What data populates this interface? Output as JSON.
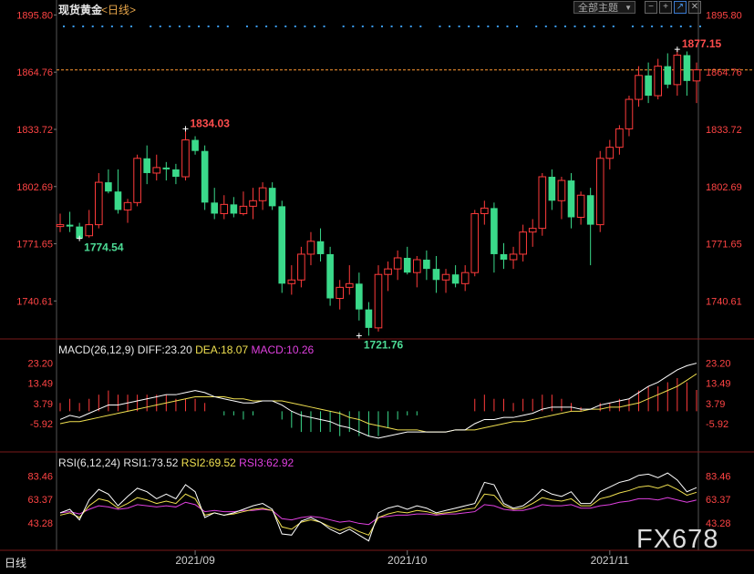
{
  "header": {
    "title": "现货黄金",
    "period": "<日线>",
    "theme_label": "全部主题",
    "theme_arrow": "▼"
  },
  "toolbar": [
    {
      "name": "minus-icon",
      "glyph": "−"
    },
    {
      "name": "plus-icon",
      "glyph": "+"
    },
    {
      "name": "line-chart-icon",
      "glyph": "↗"
    },
    {
      "name": "close-icon",
      "glyph": "✕"
    }
  ],
  "colors": {
    "up": "#ff3b3b",
    "down": "#3ad98a",
    "axis_up": "#ff4444",
    "diff": "#ffffff",
    "dea": "#f0e050",
    "macd": "#e040e0",
    "rsi1": "#ffffff",
    "rsi2": "#f0e050",
    "rsi3": "#e040e0",
    "ref": "#ff9933",
    "dots": "#3a9af0"
  },
  "bottom_tab": "日线",
  "watermark": "FX678",
  "chart_data": [
    {
      "type": "candlestick",
      "title": "现货黄金",
      "yticks": [
        "1895.80",
        "1864.76",
        "1833.72",
        "1802.69",
        "1771.65",
        "1740.61"
      ],
      "ylim": [
        1720,
        1897
      ],
      "xlabels": [
        {
          "i": 14,
          "label": "2021/09"
        },
        {
          "i": 36,
          "label": "2021/10"
        },
        {
          "i": 57,
          "label": "2021/11"
        }
      ],
      "current_price": 1866,
      "annotations": [
        {
          "label": "1834.03",
          "i": 13,
          "value": 1834.03,
          "kind": "high"
        },
        {
          "label": "1774.54",
          "i": 2,
          "value": 1774.54,
          "kind": "low"
        },
        {
          "label": "1721.76",
          "i": 31,
          "value": 1721.76,
          "kind": "low"
        },
        {
          "label": "1877.15",
          "i": 64,
          "value": 1877.15,
          "kind": "high"
        }
      ],
      "ohlc": [
        [
          1781,
          1788,
          1778,
          1782
        ],
        [
          1782,
          1789,
          1778,
          1781
        ],
        [
          1781,
          1783,
          1774.54,
          1774.5
        ],
        [
          1776,
          1790,
          1775,
          1782
        ],
        [
          1782,
          1810,
          1780,
          1805
        ],
        [
          1805,
          1812,
          1799,
          1800
        ],
        [
          1800,
          1812,
          1788,
          1790
        ],
        [
          1790,
          1796,
          1783,
          1794
        ],
        [
          1794,
          1820,
          1792,
          1818
        ],
        [
          1818,
          1825,
          1804,
          1810
        ],
        [
          1810,
          1820,
          1806,
          1813
        ],
        [
          1813,
          1816,
          1806,
          1812
        ],
        [
          1812,
          1815,
          1804,
          1808
        ],
        [
          1808,
          1834.03,
          1806,
          1828
        ],
        [
          1828,
          1830,
          1820,
          1822
        ],
        [
          1822,
          1825,
          1790,
          1794
        ],
        [
          1794,
          1802,
          1785,
          1788
        ],
        [
          1788,
          1798,
          1785,
          1793
        ],
        [
          1793,
          1797,
          1786,
          1788
        ],
        [
          1788,
          1800,
          1787,
          1792
        ],
        [
          1792,
          1802,
          1785,
          1795
        ],
        [
          1795,
          1805,
          1790,
          1802
        ],
        [
          1802,
          1805,
          1790,
          1792
        ],
        [
          1792,
          1795,
          1745,
          1750
        ],
        [
          1750,
          1760,
          1744,
          1752
        ],
        [
          1752,
          1770,
          1748,
          1766
        ],
        [
          1766,
          1778,
          1760,
          1773
        ],
        [
          1773,
          1780,
          1762,
          1766
        ],
        [
          1766,
          1770,
          1738,
          1742
        ],
        [
          1742,
          1752,
          1736,
          1748
        ],
        [
          1748,
          1760,
          1744,
          1750
        ],
        [
          1750,
          1756,
          1730,
          1736
        ],
        [
          1736,
          1740,
          1721.76,
          1726
        ],
        [
          1726,
          1760,
          1724,
          1755
        ],
        [
          1755,
          1762,
          1746,
          1758
        ],
        [
          1758,
          1768,
          1752,
          1764
        ],
        [
          1764,
          1770,
          1755,
          1756
        ],
        [
          1756,
          1765,
          1748,
          1763
        ],
        [
          1763,
          1768,
          1752,
          1758
        ],
        [
          1758,
          1765,
          1745,
          1752
        ],
        [
          1752,
          1758,
          1745,
          1755
        ],
        [
          1755,
          1760,
          1748,
          1750
        ],
        [
          1750,
          1760,
          1746,
          1756
        ],
        [
          1756,
          1790,
          1754,
          1788
        ],
        [
          1788,
          1795,
          1782,
          1791
        ],
        [
          1791,
          1794,
          1756,
          1766
        ],
        [
          1766,
          1772,
          1758,
          1763
        ],
        [
          1763,
          1770,
          1758,
          1766
        ],
        [
          1766,
          1782,
          1762,
          1778
        ],
        [
          1778,
          1785,
          1770,
          1780
        ],
        [
          1780,
          1810,
          1776,
          1808
        ],
        [
          1808,
          1812,
          1790,
          1795
        ],
        [
          1795,
          1808,
          1785,
          1806
        ],
        [
          1806,
          1810,
          1780,
          1786
        ],
        [
          1786,
          1800,
          1782,
          1798
        ],
        [
          1798,
          1802,
          1760,
          1782
        ],
        [
          1782,
          1822,
          1778,
          1818
        ],
        [
          1818,
          1828,
          1812,
          1824
        ],
        [
          1824,
          1836,
          1820,
          1834
        ],
        [
          1834,
          1852,
          1830,
          1850
        ],
        [
          1850,
          1868,
          1846,
          1863
        ],
        [
          1863,
          1870,
          1848,
          1852
        ],
        [
          1852,
          1872,
          1850,
          1868
        ],
        [
          1868,
          1875,
          1856,
          1858
        ],
        [
          1858,
          1877.15,
          1852,
          1874
        ],
        [
          1874,
          1876,
          1852,
          1860
        ],
        [
          1860,
          1870,
          1848,
          1866
        ]
      ]
    },
    {
      "type": "macd_indicator",
      "title": "MACD(26,12,9)",
      "legend": [
        {
          "key": "DIFF",
          "text": "DIFF:23.20"
        },
        {
          "key": "DEA",
          "text": "DEA:18.07"
        },
        {
          "key": "MACD",
          "text": "MACD:10.26"
        }
      ],
      "yticks": [
        "23.20",
        "13.49",
        "3.79",
        "-5.92"
      ],
      "ylim": [
        -17,
        27
      ],
      "diff": [
        -4,
        -2,
        -3,
        -1,
        1,
        3,
        3,
        4,
        5,
        6,
        7,
        8,
        8,
        9,
        10,
        9,
        7,
        6,
        5,
        4,
        4,
        5,
        5,
        3,
        0,
        -2,
        -3,
        -4,
        -5,
        -7,
        -8,
        -10,
        -12,
        -13,
        -12,
        -11,
        -10,
        -10,
        -10,
        -10,
        -10,
        -9,
        -9,
        -6,
        -4,
        -4,
        -3,
        -3,
        -2,
        -1,
        1,
        2,
        2,
        2,
        1,
        1,
        3,
        4,
        5,
        6,
        9,
        12,
        14,
        17,
        20,
        22,
        23.2
      ],
      "dea": [
        -6,
        -5,
        -5,
        -4,
        -3,
        -2,
        -1,
        0,
        1,
        2,
        3,
        4,
        5,
        6,
        7,
        7,
        7,
        7,
        6,
        6,
        5,
        5,
        5,
        5,
        4,
        3,
        2,
        1,
        0,
        -1,
        -3,
        -4,
        -6,
        -7,
        -8,
        -9,
        -9,
        -9,
        -10,
        -10,
        -10,
        -9,
        -9,
        -9,
        -8,
        -7,
        -6,
        -5,
        -5,
        -4,
        -3,
        -2,
        -1,
        0,
        0,
        1,
        1,
        2,
        2,
        3,
        4,
        6,
        8,
        10,
        12,
        15,
        18.07
      ]
    },
    {
      "type": "rsi_indicator",
      "title": "RSI(6,12,24)",
      "legend": [
        {
          "key": "RSI1",
          "text": "RSI1:73.52"
        },
        {
          "key": "RSI2",
          "text": "RSI2:69.52"
        },
        {
          "key": "RSI3",
          "text": "RSI3:62.92"
        }
      ],
      "yticks": [
        "83.46",
        "63.37",
        "43.28"
      ],
      "ylim": [
        20,
        90
      ],
      "rsi1": [
        52,
        55,
        46,
        63,
        72,
        68,
        58,
        66,
        73,
        70,
        64,
        68,
        64,
        76,
        70,
        48,
        52,
        50,
        52,
        55,
        58,
        60,
        55,
        34,
        33,
        45,
        48,
        44,
        38,
        34,
        38,
        33,
        28,
        52,
        56,
        58,
        55,
        58,
        56,
        52,
        54,
        56,
        58,
        60,
        78,
        76,
        60,
        56,
        58,
        64,
        72,
        68,
        66,
        70,
        60,
        60,
        70,
        74,
        78,
        80,
        84,
        85,
        82,
        86,
        80,
        70,
        73.52
      ],
      "rsi2": [
        50,
        52,
        48,
        58,
        64,
        62,
        56,
        60,
        65,
        63,
        60,
        62,
        60,
        68,
        64,
        50,
        52,
        50,
        51,
        53,
        55,
        56,
        54,
        40,
        38,
        44,
        46,
        44,
        40,
        37,
        40,
        36,
        33,
        48,
        51,
        53,
        52,
        54,
        53,
        51,
        52,
        53,
        55,
        56,
        68,
        67,
        58,
        55,
        56,
        60,
        65,
        63,
        62,
        64,
        58,
        58,
        64,
        66,
        69,
        71,
        74,
        75,
        73,
        76,
        72,
        67,
        69.52
      ],
      "rsi3": [
        52,
        53,
        51,
        55,
        58,
        57,
        55,
        56,
        59,
        58,
        57,
        58,
        57,
        61,
        59,
        53,
        54,
        53,
        53,
        54,
        54,
        55,
        54,
        47,
        46,
        48,
        49,
        48,
        46,
        44,
        45,
        43,
        42,
        48,
        49,
        50,
        50,
        51,
        51,
        50,
        51,
        51,
        52,
        53,
        59,
        58,
        55,
        54,
        54,
        56,
        59,
        58,
        58,
        59,
        56,
        56,
        58,
        59,
        61,
        62,
        64,
        64,
        63,
        65,
        63,
        61,
        62.92
      ]
    }
  ]
}
